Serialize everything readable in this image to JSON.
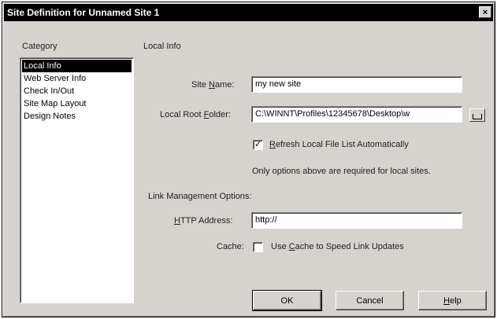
{
  "window": {
    "title": "Site Definition for Unnamed Site 1",
    "close_glyph": "×"
  },
  "category": {
    "label": "Category",
    "items": [
      {
        "label": "Local Info",
        "selected": true
      },
      {
        "label": "Web Server Info",
        "selected": false
      },
      {
        "label": "Check In/Out",
        "selected": false
      },
      {
        "label": "Site Map Layout",
        "selected": false
      },
      {
        "label": "Design Notes",
        "selected": false
      }
    ]
  },
  "panel": {
    "heading": "Local Info",
    "site_name": {
      "label_pre": "Site ",
      "label_key": "N",
      "label_post": "ame:",
      "value": "my new site"
    },
    "local_root": {
      "label_pre": "Local Root ",
      "label_key": "F",
      "label_post": "older:",
      "value": "C:\\WINNT\\Profiles\\12345678\\Desktop\\w"
    },
    "refresh": {
      "label_key": "R",
      "label_post": "efresh Local File List Automatically",
      "checked": true,
      "check_glyph": "✓"
    },
    "note": "Only options above are required for local sites.",
    "link_mgmt_label": "Link Management Options:",
    "http": {
      "label_key": "H",
      "label_post": "TTP Address:",
      "value": "http://"
    },
    "cache": {
      "label": "Cache:",
      "option_pre": "Use ",
      "option_key": "C",
      "option_post": "ache to Speed Link Updates",
      "checked": false
    }
  },
  "buttons": {
    "ok": "OK",
    "cancel": "Cancel",
    "help_key": "H",
    "help_post": "elp"
  },
  "icons": {
    "folder": "folder-icon",
    "close": "close-icon"
  }
}
